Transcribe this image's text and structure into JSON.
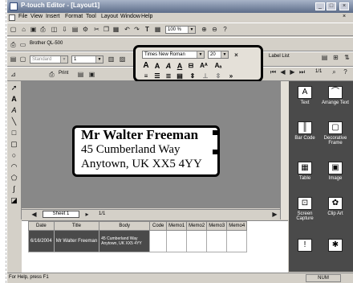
{
  "window": {
    "title": "P-touch Editor - [Layout1]"
  },
  "menu": [
    "File",
    "View",
    "Insert",
    "Format",
    "Tool",
    "Layout",
    "Window",
    "Help"
  ],
  "toolbar": {
    "zoom": "100 %"
  },
  "property_bar": {
    "printer": "Brother QL-500",
    "paper": "Standard",
    "length": "1",
    "print_label": "Print"
  },
  "font_bar": {
    "font": "Times New Roman",
    "size": "20"
  },
  "label_list": {
    "title": "Label List",
    "page_counter": "1/1"
  },
  "label": {
    "line1": "Mr Walter Freeman",
    "line2": "45 Cumberland Way",
    "line3": "Anytown, UK XX5 4YY"
  },
  "sheet": {
    "tab": "Sheet 1",
    "page": "1/1"
  },
  "database": {
    "columns": [
      "Date",
      "Title",
      "Body",
      "Code",
      "Memo1",
      "Memo2",
      "Memo3",
      "Memo4"
    ],
    "row": {
      "date": "6/16/2004",
      "title": "Mr Walter Freeman",
      "body": "45 Cumberland Way Anytown, UK XX5 4YY"
    }
  },
  "side_panel": [
    "Text",
    "Arrange Text",
    "Bar Code",
    "Decorative Frame",
    "Table",
    "Image",
    "Screen Capture",
    "Clip Art"
  ],
  "status": {
    "text": "For Help, press F1",
    "num": "NUM"
  }
}
